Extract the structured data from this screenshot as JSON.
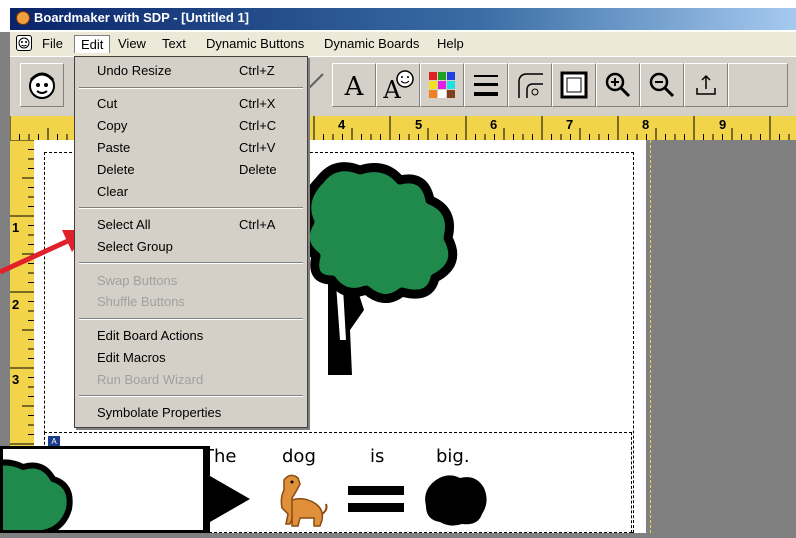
{
  "window": {
    "title": "Boardmaker with SDP - [Untitled 1]"
  },
  "menubar": {
    "items": [
      "File",
      "Edit",
      "View",
      "Text",
      "Dynamic Buttons",
      "Dynamic Boards",
      "Help"
    ]
  },
  "edit_menu": {
    "undo": {
      "label": "Undo Resize",
      "shortcut": "Ctrl+Z"
    },
    "cut": {
      "label": "Cut",
      "shortcut": "Ctrl+X"
    },
    "copy": {
      "label": "Copy",
      "shortcut": "Ctrl+C"
    },
    "paste": {
      "label": "Paste",
      "shortcut": "Ctrl+V"
    },
    "delete": {
      "label": "Delete",
      "shortcut": "Delete"
    },
    "clear": {
      "label": "Clear"
    },
    "select_all": {
      "label": "Select All",
      "shortcut": "Ctrl+A"
    },
    "select_group": {
      "label": "Select Group"
    },
    "swap_buttons": {
      "label": "Swap Buttons"
    },
    "shuffle_buttons": {
      "label": "Shuffle Buttons"
    },
    "edit_board_actions": {
      "label": "Edit Board Actions"
    },
    "edit_macros": {
      "label": "Edit Macros"
    },
    "run_board_wizard": {
      "label": "Run Board Wizard"
    },
    "symbolate_properties": {
      "label": "Symbolate Properties"
    }
  },
  "ruler": {
    "top_numbers": [
      "4",
      "5",
      "6",
      "7",
      "8",
      "9"
    ],
    "left_numbers": [
      "1",
      "2",
      "3"
    ]
  },
  "sentence": {
    "words": [
      "The",
      "dog",
      "is",
      "big."
    ]
  },
  "colors": {
    "tree_green": "#1f8a4c",
    "arrow_red": "#e0202a",
    "ruler_yellow": "#f2d44b"
  }
}
